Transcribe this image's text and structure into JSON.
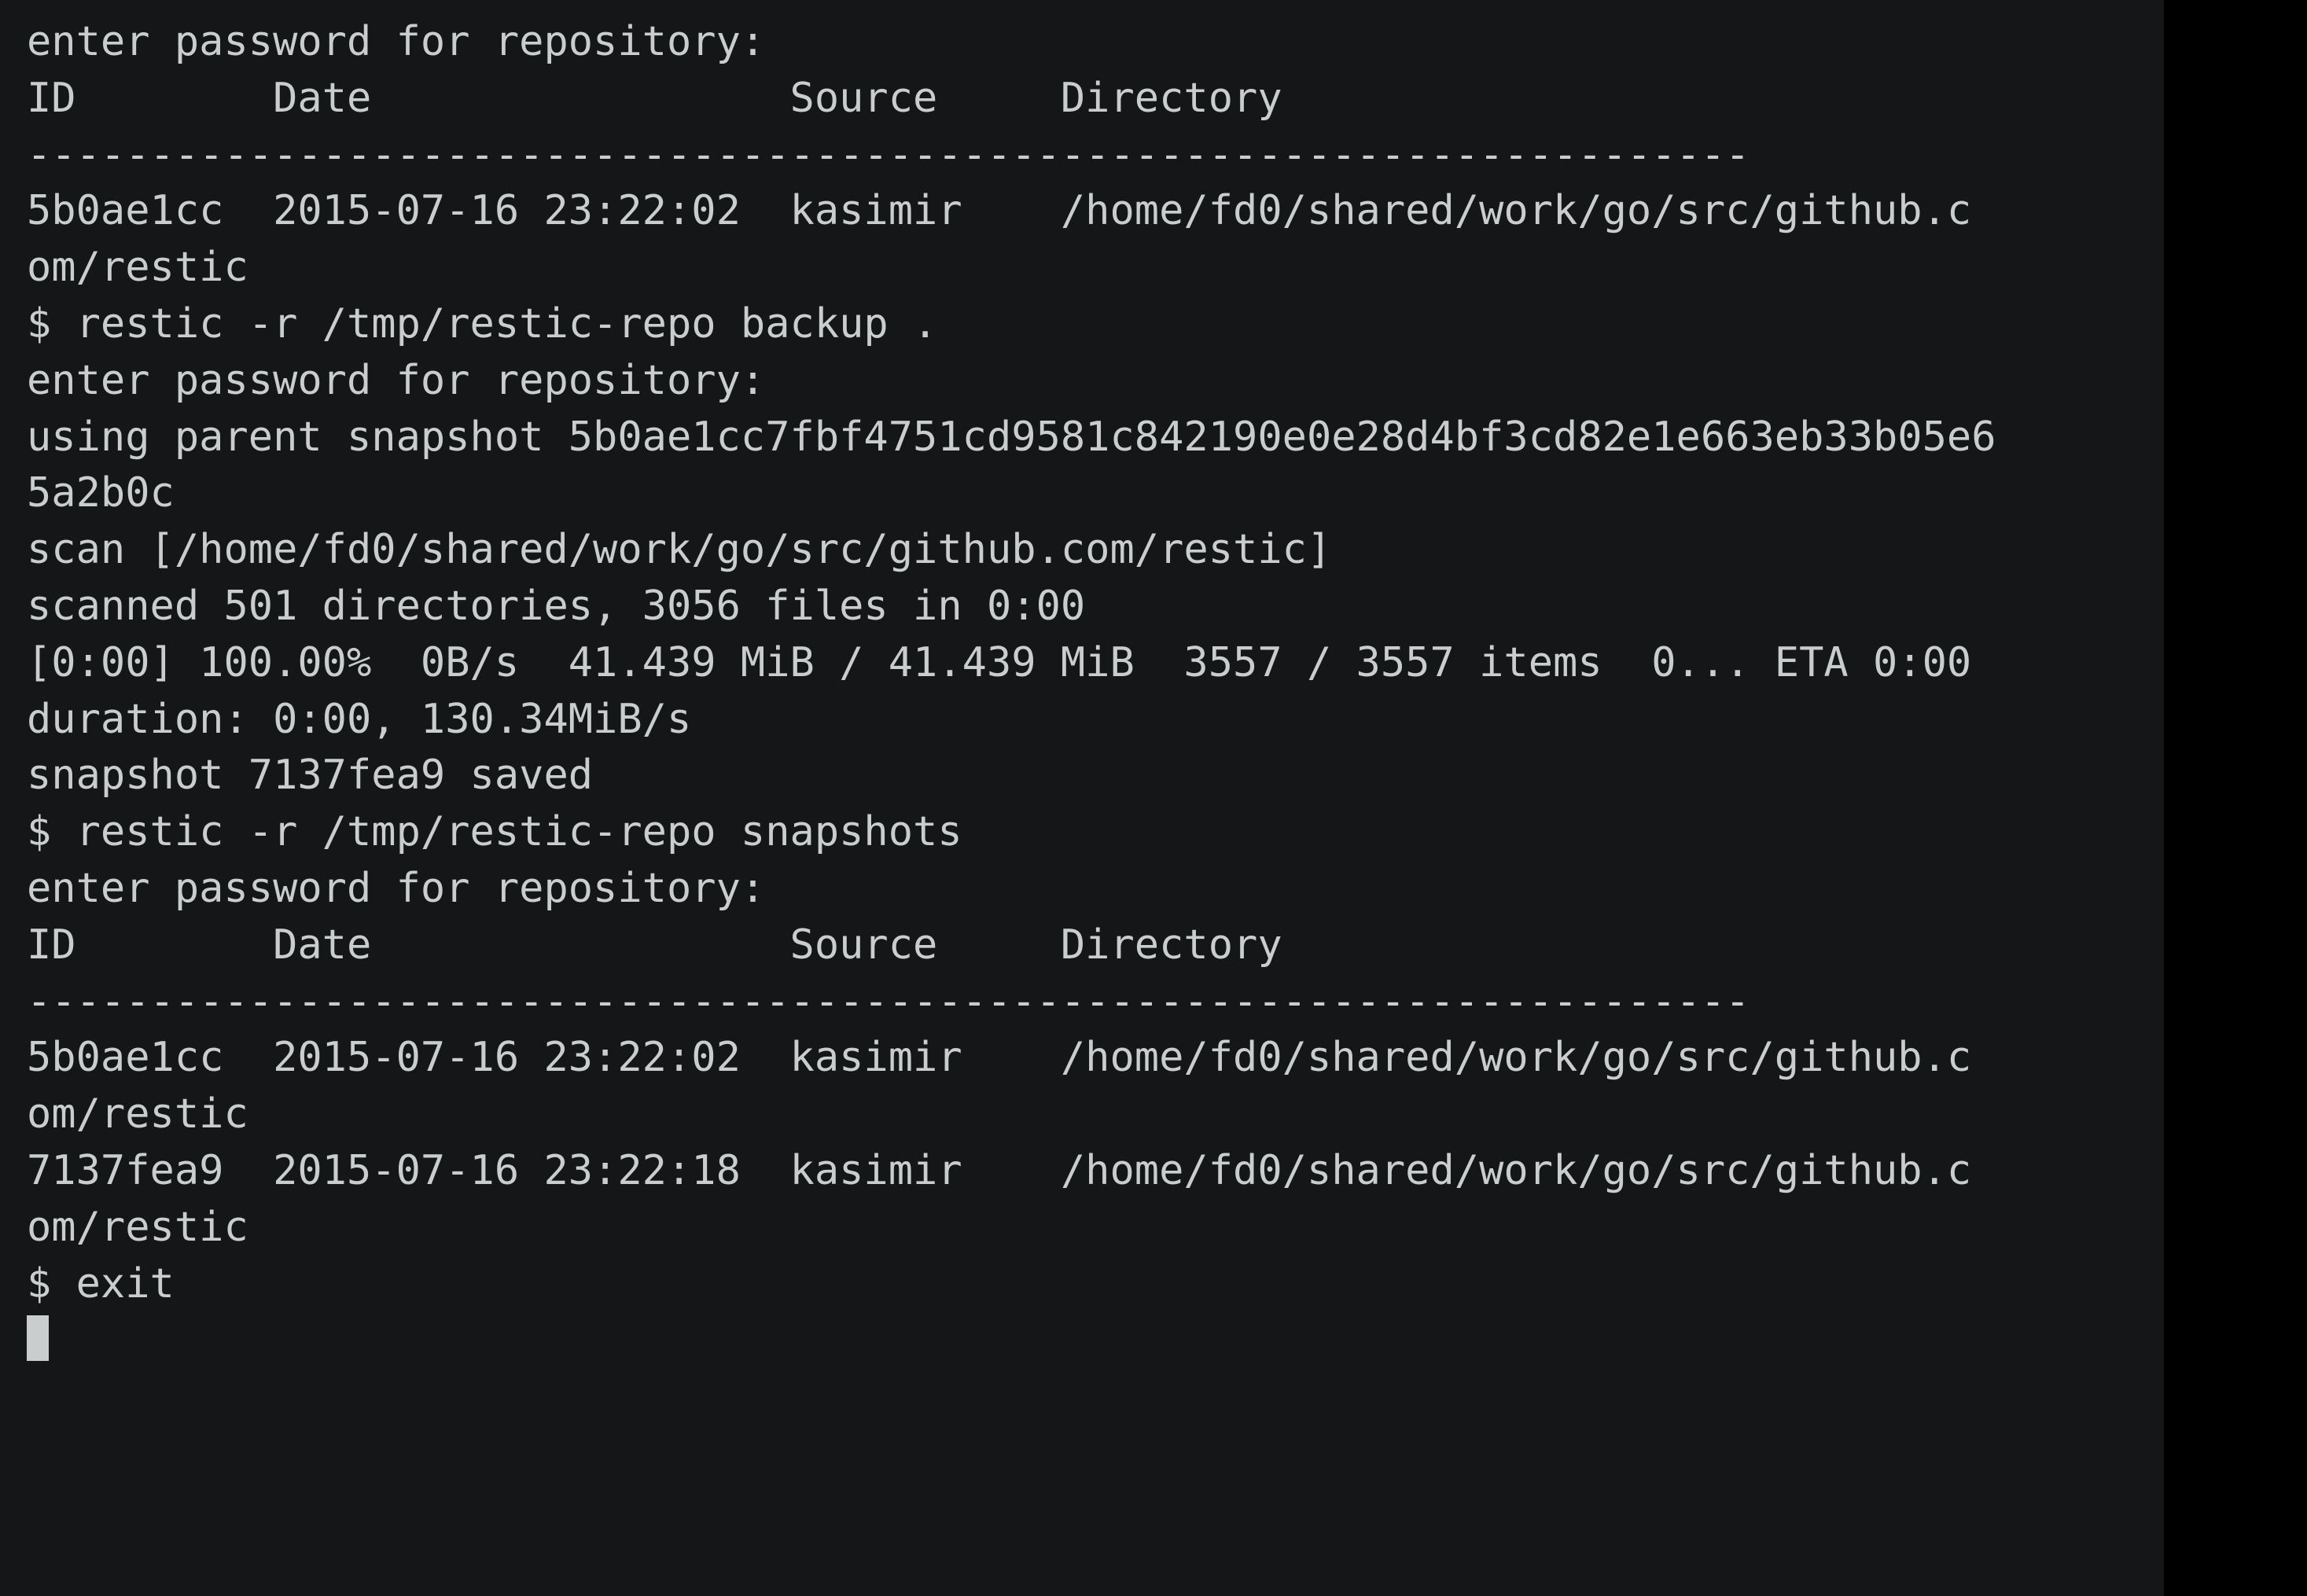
{
  "terminal": {
    "background_color": "#141618",
    "foreground_color": "#c9cdcd",
    "window_background_color": "#000000",
    "cursor_color": "#c9cdcd",
    "prompt_symbol": "$",
    "lines": [
      "enter password for repository:",
      "ID        Date                 Source     Directory",
      "----------------------------------------------------------------------",
      "5b0ae1cc  2015-07-16 23:22:02  kasimir    /home/fd0/shared/work/go/src/github.c",
      "om/restic",
      "$ restic -r /tmp/restic-repo backup .",
      "enter password for repository:",
      "using parent snapshot 5b0ae1cc7fbf4751cd9581c842190e0e28d4bf3cd82e1e663eb33b05e6",
      "5a2b0c",
      "scan [/home/fd0/shared/work/go/src/github.com/restic]",
      "scanned 501 directories, 3056 files in 0:00",
      "[0:00] 100.00%  0B/s  41.439 MiB / 41.439 MiB  3557 / 3557 items  0... ETA 0:00",
      "duration: 0:00, 130.34MiB/s",
      "snapshot 7137fea9 saved",
      "$ restic -r /tmp/restic-repo snapshots",
      "enter password for repository:",
      "ID        Date                 Source     Directory",
      "----------------------------------------------------------------------",
      "5b0ae1cc  2015-07-16 23:22:02  kasimir    /home/fd0/shared/work/go/src/github.c",
      "om/restic",
      "7137fea9  2015-07-16 23:22:18  kasimir    /home/fd0/shared/work/go/src/github.c",
      "om/restic",
      "$ exit"
    ],
    "snapshots_table": {
      "headers": [
        "ID",
        "Date",
        "Source",
        "Directory"
      ],
      "separator": "----------------------------------------------------------------------",
      "first_listing_rows": [
        {
          "id": "5b0ae1cc",
          "date": "2015-07-16 23:22:02",
          "source": "kasimir",
          "directory": "/home/fd0/shared/work/go/src/github.com/restic"
        }
      ],
      "second_listing_rows": [
        {
          "id": "5b0ae1cc",
          "date": "2015-07-16 23:22:02",
          "source": "kasimir",
          "directory": "/home/fd0/shared/work/go/src/github.com/restic"
        },
        {
          "id": "7137fea9",
          "date": "2015-07-16 23:22:18",
          "source": "kasimir",
          "directory": "/home/fd0/shared/work/go/src/github.com/restic"
        }
      ]
    },
    "commands": [
      "restic -r /tmp/restic-repo backup .",
      "restic -r /tmp/restic-repo snapshots",
      "exit"
    ],
    "backup_run": {
      "password_prompt": "enter password for repository:",
      "parent_snapshot_id": "5b0ae1cc7fbf4751cd9581c842190e0e28d4bf3cd82e1e663eb33b05e65a2b0c",
      "scan_path": "/home/fd0/shared/work/go/src/github.com/restic",
      "scanned_directories": "501",
      "scanned_files": "3056",
      "scan_time": "0:00",
      "progress_elapsed": "[0:00]",
      "progress_percent": "100.00%",
      "progress_rate": "0B/s",
      "progress_bytes_done": "41.439 MiB",
      "progress_bytes_total": "41.439 MiB",
      "progress_items_done": "3557",
      "progress_items_total": "3557",
      "progress_trailing": "0...",
      "progress_eta": "ETA 0:00",
      "duration": "0:00",
      "throughput": "130.34MiB/s",
      "saved_snapshot_id": "7137fea9"
    },
    "cursor": {
      "visible": true,
      "shape": "block"
    }
  }
}
